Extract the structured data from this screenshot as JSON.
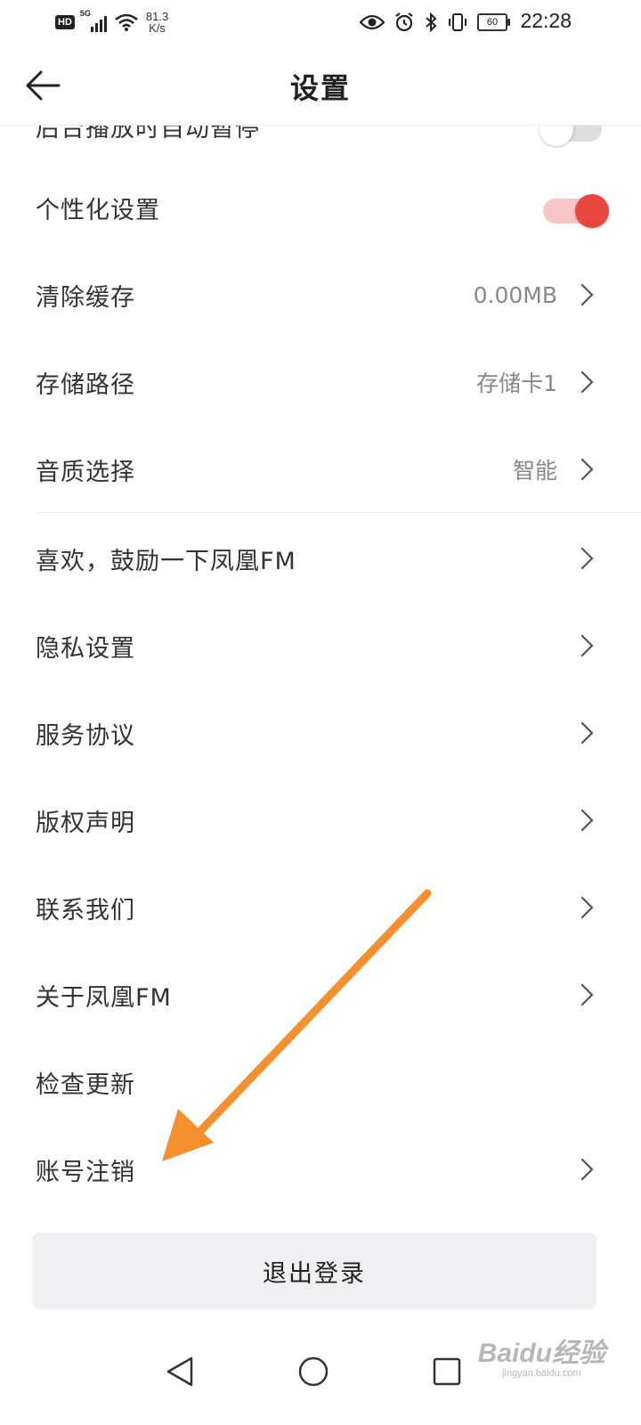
{
  "status_bar": {
    "hd": "HD",
    "network": "5G",
    "speed_value": "81.3",
    "speed_unit": "K/s",
    "battery": "60",
    "time": "22:28"
  },
  "header": {
    "title": "设置"
  },
  "settings": {
    "partial_top_row": {
      "label": "后台播放时自动暂停",
      "toggle_on": false
    },
    "personalization": {
      "label": "个性化设置",
      "toggle_on": true
    },
    "clear_cache": {
      "label": "清除缓存",
      "value": "0.00MB"
    },
    "storage_path": {
      "label": "存储路径",
      "value": "存储卡1"
    },
    "audio_quality": {
      "label": "音质选择",
      "value": "智能"
    },
    "rate_app": {
      "label": "喜欢，鼓励一下凤凰FM"
    },
    "privacy": {
      "label": "隐私设置"
    },
    "service_agreement": {
      "label": "服务协议"
    },
    "copyright": {
      "label": "版权声明"
    },
    "contact_us": {
      "label": "联系我们"
    },
    "about": {
      "label": "关于凤凰FM"
    },
    "check_update": {
      "label": "检查更新"
    },
    "account_deletion": {
      "label": "账号注销"
    }
  },
  "logout": {
    "label": "退出登录"
  },
  "watermark": {
    "main": "Baidu经验",
    "sub": "jingyan.baidu.com"
  },
  "colors": {
    "accent_red": "#e8473f",
    "arrow_orange": "#f5902f",
    "text_primary": "#333333",
    "text_secondary": "#888888"
  },
  "icons": {
    "back": "arrow-left-icon",
    "chevron": "chevron-right-icon",
    "nav_back": "triangle-back-icon",
    "nav_home": "circle-home-icon",
    "nav_recent": "square-recent-icon"
  }
}
